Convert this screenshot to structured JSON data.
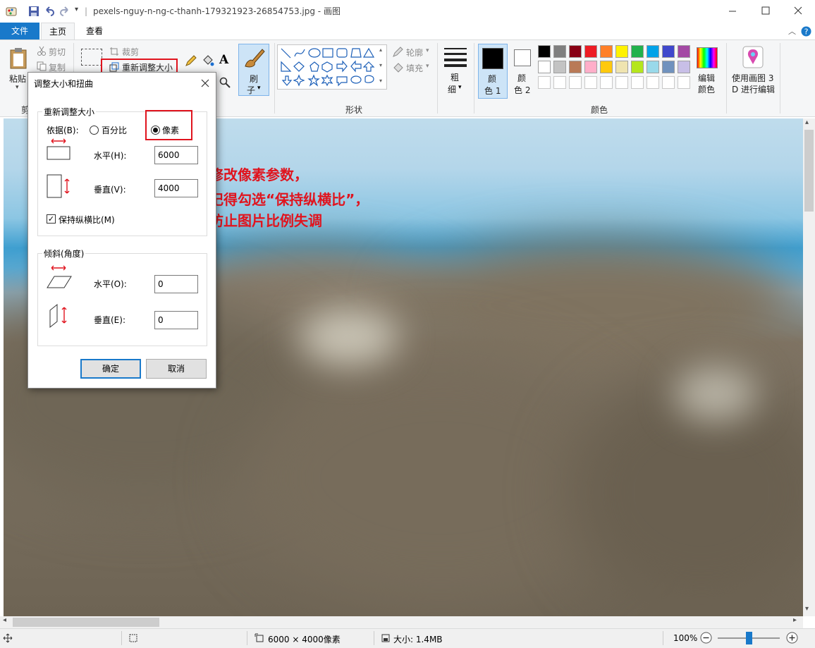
{
  "window": {
    "title": "pexels-nguy-n-ng-c-thanh-179321923-26854753.jpg - 画图",
    "qat_sep": "|"
  },
  "tabs": {
    "file": "文件",
    "home": "主页",
    "view": "查看"
  },
  "ribbon": {
    "clipboard": {
      "paste": "粘贴",
      "cut": "剪切",
      "copy": "复制",
      "label": "剪"
    },
    "image": {
      "crop": "裁剪",
      "resize": "重新调整大小"
    },
    "brush": {
      "line1": "刷",
      "line2": "子"
    },
    "shapes": {
      "outline": "轮廓",
      "fill": "填充",
      "label": "形状"
    },
    "size": {
      "line1": "粗",
      "line2": "细"
    },
    "color1": {
      "line1": "颜",
      "line2": "色 1"
    },
    "color2": {
      "line1": "颜",
      "line2": "色 2"
    },
    "colors_label": "颜色",
    "edit_colors": {
      "line1": "编辑",
      "line2": "颜色"
    },
    "paint3d": {
      "line1": "使用画图 3",
      "line2": "D 进行编辑"
    },
    "colors": {
      "row1": [
        "#000000",
        "#7f7f7f",
        "#880015",
        "#ed1c24",
        "#ff7f27",
        "#fff200",
        "#22b14c",
        "#00a2e8",
        "#3f48cc",
        "#a349a4"
      ],
      "row2": [
        "#ffffff",
        "#c3c3c3",
        "#b97a57",
        "#ffaec9",
        "#ffc90e",
        "#efe4b0",
        "#b5e61d",
        "#99d9ea",
        "#7092be",
        "#c8bfe7"
      ]
    }
  },
  "dialog": {
    "title": "调整大小和扭曲",
    "resize_group": "重新调整大小",
    "by_label": "依据(B):",
    "percent": "百分比",
    "pixels": "像素",
    "horizontal_label": "水平(H):",
    "horizontal_value": "6000",
    "vertical_label": "垂直(V):",
    "vertical_value": "4000",
    "keep_ratio": "保持纵横比(M)",
    "skew_group": "倾斜(角度)",
    "skew_h_label": "水平(O):",
    "skew_h_value": "0",
    "skew_v_label": "垂直(E):",
    "skew_v_value": "0",
    "ok": "确定",
    "cancel": "取消"
  },
  "annotation": {
    "line1": "修改像素参数，",
    "line2": "记得勾选“保持纵横比”，",
    "line3": "防止图片比例失调"
  },
  "status": {
    "dimensions": "6000 × 4000像素",
    "filesize": "大小: 1.4MB",
    "zoom": "100%"
  }
}
